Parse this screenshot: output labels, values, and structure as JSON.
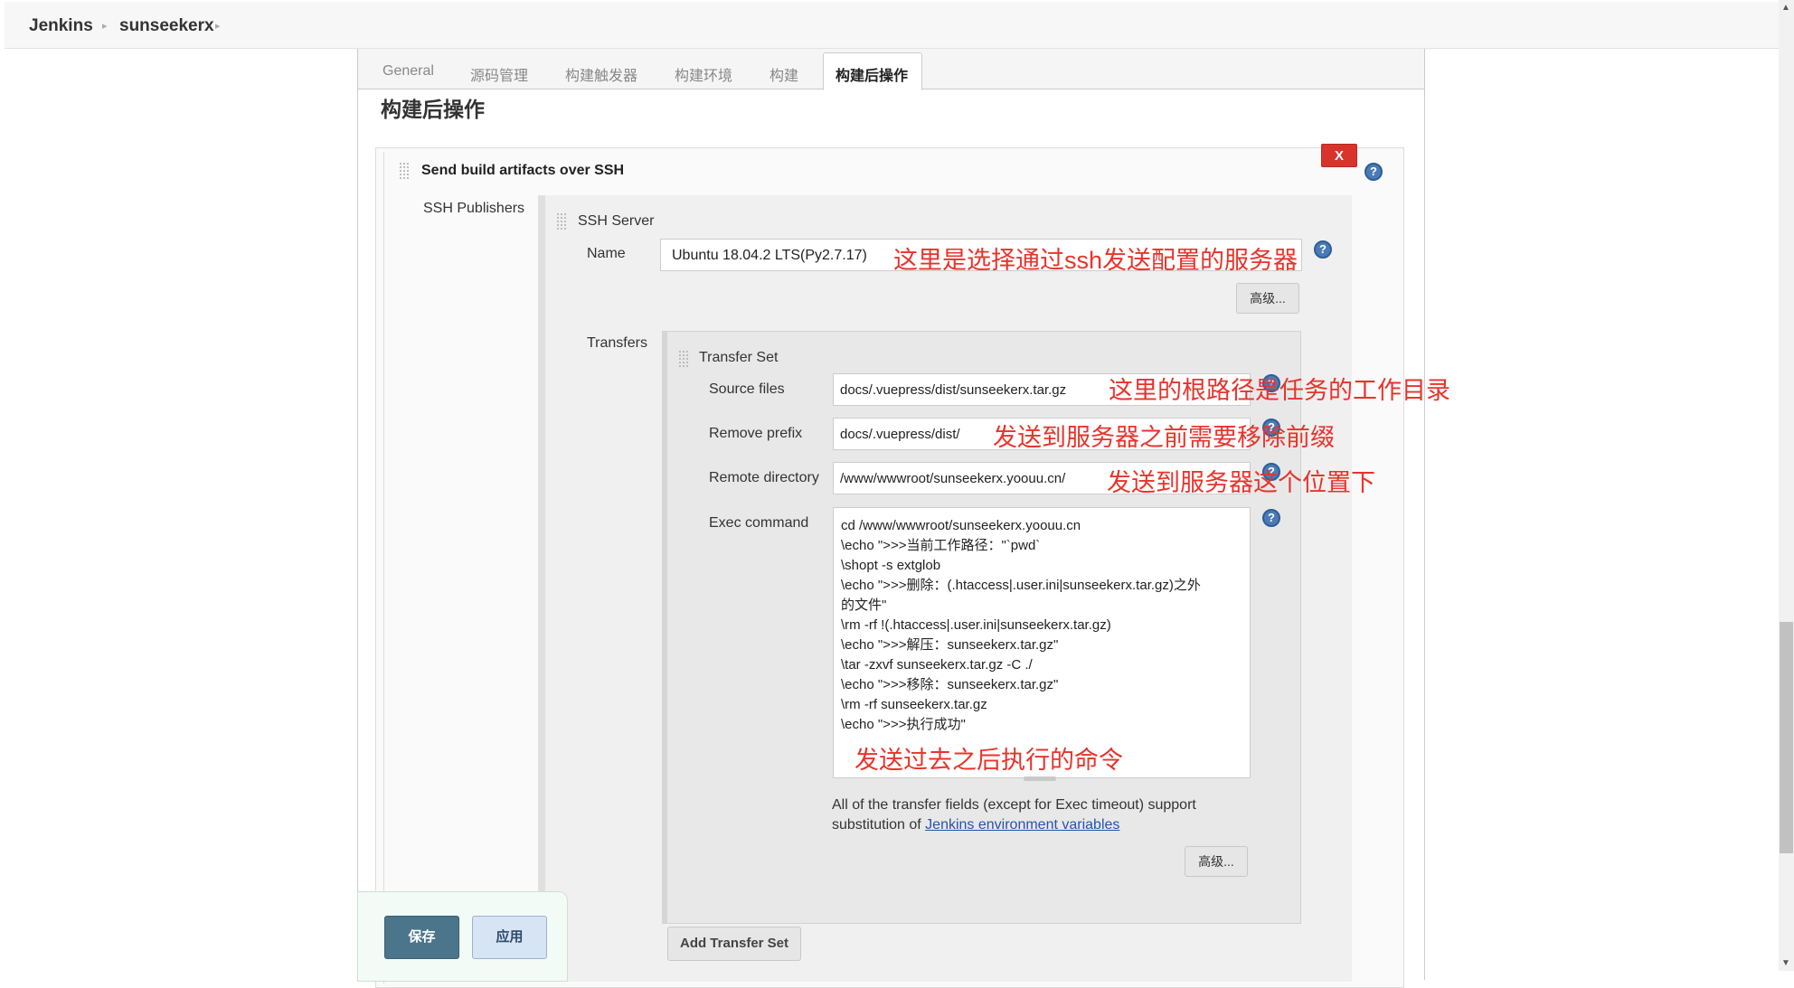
{
  "breadcrumb": {
    "items": [
      "Jenkins",
      "sunseekerx"
    ]
  },
  "tabs": [
    "General",
    "源码管理",
    "构建触发器",
    "构建环境",
    "构建",
    "构建后操作"
  ],
  "active_tab": "构建后操作",
  "section_title": "构建后操作",
  "publisher": {
    "title": "Send build artifacts over SSH",
    "delete_label": "X",
    "help_label": "?",
    "ssh_publishers_label": "SSH Publishers",
    "ssh_server": {
      "title": "SSH Server",
      "name_label": "Name",
      "name_value": "Ubuntu 18.04.2 LTS(Py2.7.17)",
      "advanced_label": "高级..."
    },
    "transfers_label": "Transfers",
    "transfer_set": {
      "title": "Transfer Set",
      "source_files_label": "Source files",
      "source_files_value": "docs/.vuepress/dist/sunseekerx.tar.gz",
      "remove_prefix_label": "Remove prefix",
      "remove_prefix_value": "docs/.vuepress/dist/",
      "remote_directory_label": "Remote directory",
      "remote_directory_value": "/www/wwwroot/sunseekerx.yoouu.cn/",
      "exec_command_label": "Exec command",
      "exec_command_lines": [
        "cd /www/wwwroot/sunseekerx.yoouu.cn",
        "\\echo \">>>当前工作路径：\"`pwd`",
        "\\shopt -s extglob",
        "\\echo \">>>删除：(.htaccess|.user.ini|sunseekerx.tar.gz)之外",
        "的文件\"",
        "\\rm -rf !(.htaccess|.user.ini|sunseekerx.tar.gz)",
        "\\echo \">>>解压：sunseekerx.tar.gz\"",
        "\\tar -zxvf sunseekerx.tar.gz -C ./",
        "\\echo \">>>移除：sunseekerx.tar.gz\"",
        "\\rm -rf sunseekerx.tar.gz",
        "\\echo \">>>执行成功\""
      ],
      "note_text": "All of the transfer fields (except for Exec timeout) support substitution of ",
      "note_link": "Jenkins environment variables",
      "advanced_label": "高级..."
    },
    "add_transfer_set_label": "Add Transfer Set"
  },
  "buttons": {
    "save": "保存",
    "apply": "应用"
  },
  "annotations": {
    "name": "这里是选择通过ssh发送配置的服务器",
    "source_files": "这里的根路径是任务的工作目录",
    "remove_prefix": "发送到服务器之前需要移除前缀",
    "remote_directory": "发送到服务器这个位置下",
    "exec_command": "发送过去之后执行的命令"
  },
  "colors": {
    "annotation": "#e8332b",
    "delete": "#d9342b",
    "save": "#4b758b",
    "link": "#2255aa"
  }
}
